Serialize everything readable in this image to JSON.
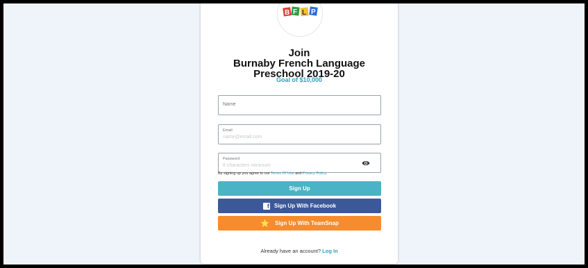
{
  "signup": {
    "title_line1": "Join",
    "title_line2": "Burnaby French Language",
    "title_line3": "Preschool 2019-20",
    "goal": "Goal of $10,000",
    "fields": {
      "name_label": "Name",
      "email_label": "Email",
      "email_placeholder": "name@email.com",
      "password_label": "Password",
      "password_placeholder": "8 characters minimum"
    },
    "terms": {
      "prefix": "By signing up you agree to our ",
      "terms_link": "Terms Of Use",
      "middle": " and ",
      "privacy_link": "Privacy Policy",
      "suffix": "."
    },
    "buttons": {
      "signup": "Sign Up",
      "facebook": "Sign Up With Facebook",
      "teamsnap": "Sign Up With TeamSnap"
    },
    "login": {
      "prompt": "Already have an account? ",
      "link": "Log In"
    },
    "logo_letters": [
      "B",
      "F",
      "L",
      "P"
    ]
  },
  "colors": {
    "background": "#eff4fa",
    "accent": "#2e9fbd",
    "signup_button": "#4bb3c6",
    "facebook_button": "#3b5998",
    "teamsnap_button": "#f78c2e"
  },
  "icons": {
    "eye": "eye-icon",
    "facebook": "facebook-icon",
    "teamsnap": "teamsnap-star-icon"
  }
}
